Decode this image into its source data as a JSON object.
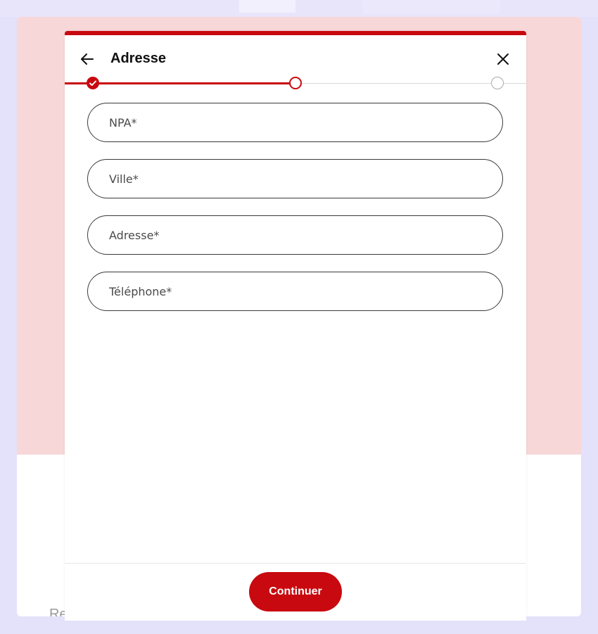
{
  "modal": {
    "title": "Adresse",
    "back_icon": "arrow-left-icon",
    "close_icon": "close-icon",
    "accent_color": "#c8090f"
  },
  "stepper": {
    "steps": [
      {
        "state": "completed",
        "icon": "check-icon"
      },
      {
        "state": "current"
      },
      {
        "state": "upcoming"
      }
    ],
    "progress": 0.5
  },
  "form": {
    "fields": [
      {
        "placeholder": "NPA*",
        "value": ""
      },
      {
        "placeholder": "Ville*",
        "value": ""
      },
      {
        "placeholder": "Adresse*",
        "value": ""
      },
      {
        "placeholder": "Téléphone*",
        "value": ""
      }
    ]
  },
  "footer": {
    "continue_label": "Continuer"
  },
  "background": {
    "partial_text": "Re"
  }
}
